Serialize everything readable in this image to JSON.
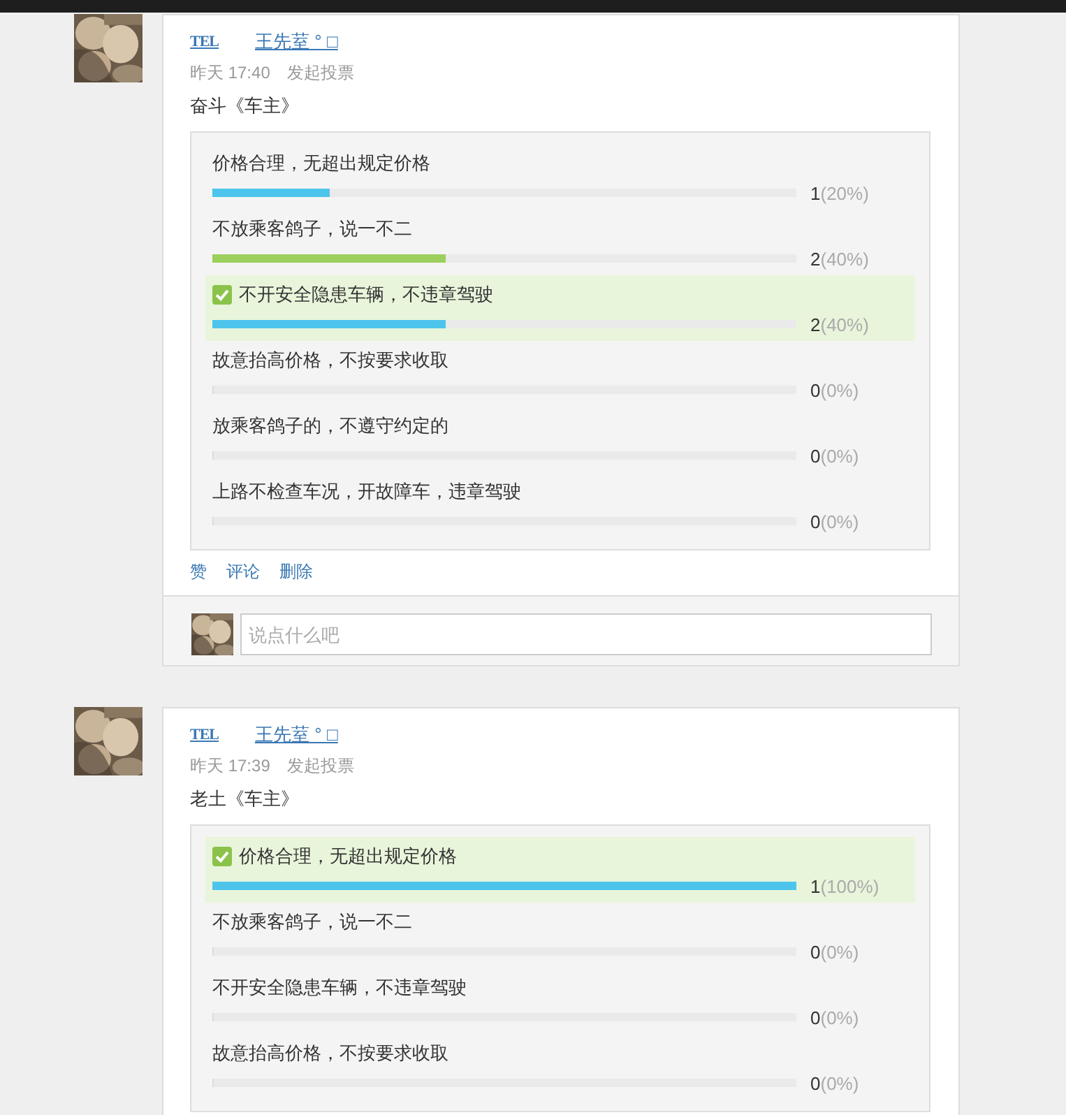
{
  "posts": [
    {
      "badge": "TEL",
      "author": "王先荎 ° □",
      "time": "昨天 17:40",
      "action": "发起投票",
      "title": "奋斗《车主》",
      "poll": [
        {
          "label": "价格合理，无超出规定价格",
          "selected": false,
          "level": 0.2,
          "color": "#4dc4ec",
          "count": "1",
          "percent": "(20%)"
        },
        {
          "label": "不放乘客鸽子，说一不二",
          "selected": false,
          "level": 0.4,
          "color": "#9ccf5c",
          "count": "2",
          "percent": "(40%)"
        },
        {
          "label": "不开安全隐患车辆，不违章驾驶",
          "selected": true,
          "level": 0.4,
          "color": "#4dc4ec",
          "count": "2",
          "percent": "(40%)"
        },
        {
          "label": "故意抬高价格，不按要求收取",
          "selected": false,
          "level": 0,
          "count": "0",
          "percent": "(0%)"
        },
        {
          "label": "放乘客鸽子的，不遵守约定的",
          "selected": false,
          "level": 0,
          "count": "0",
          "percent": "(0%)"
        },
        {
          "label": "上路不检查车况，开故障车，违章驾驶",
          "selected": false,
          "level": 0,
          "count": "0",
          "percent": "(0%)"
        }
      ],
      "links": [
        "赞",
        "评论",
        "删除"
      ],
      "comment": {
        "placeholder": "说点什么吧"
      }
    },
    {
      "badge": "TEL",
      "author": "王先荎 ° □",
      "time": "昨天 17:39",
      "action": "发起投票",
      "title": "老土《车主》",
      "poll": [
        {
          "label": "价格合理，无超出规定价格",
          "selected": true,
          "level": 1,
          "color": "#4dc4ec",
          "count": "1",
          "percent": "(100%)"
        },
        {
          "label": "不放乘客鸽子，说一不二",
          "selected": false,
          "level": 0,
          "count": "0",
          "percent": "(0%)"
        },
        {
          "label": "不开安全隐患车辆，不违章驾驶",
          "selected": false,
          "level": 0,
          "count": "0",
          "percent": "(0%)"
        },
        {
          "label": "故意抬高价格，不按要求收取",
          "selected": false,
          "level": 0,
          "count": "0",
          "percent": "(0%)"
        }
      ]
    }
  ]
}
